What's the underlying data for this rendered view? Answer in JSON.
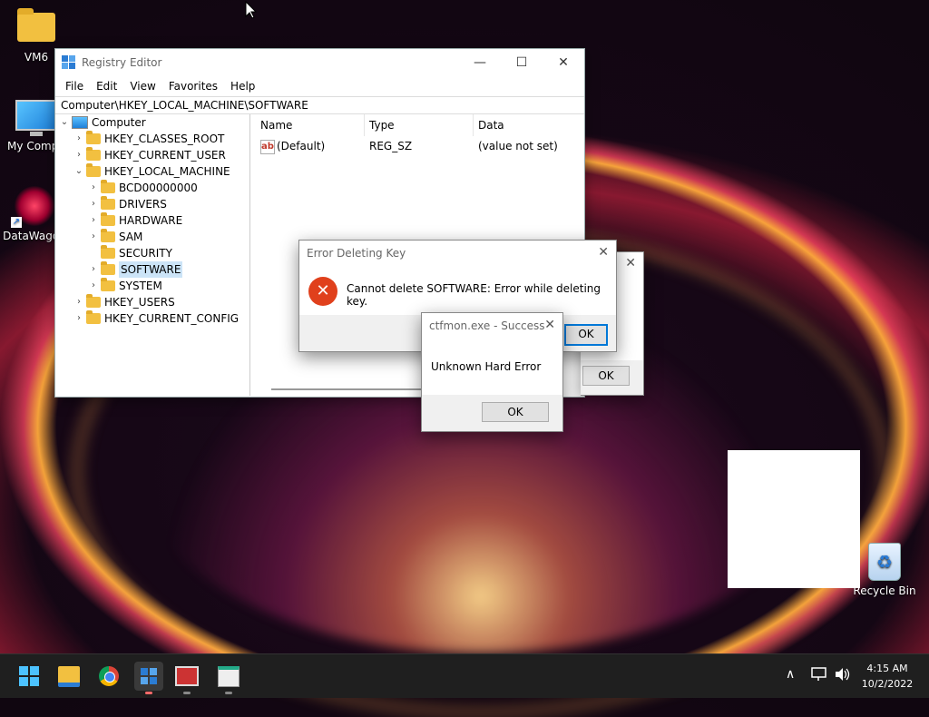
{
  "desktop": {
    "icons": [
      {
        "label": "VM6"
      },
      {
        "label": "My Compu"
      },
      {
        "label": "DataWagon"
      },
      {
        "label": "Recycle Bin"
      }
    ]
  },
  "regedit": {
    "title": "Registry Editor",
    "menu": [
      "File",
      "Edit",
      "View",
      "Favorites",
      "Help"
    ],
    "address": "Computer\\HKEY_LOCAL_MACHINE\\SOFTWARE",
    "tree": [
      {
        "label": "Computer"
      },
      {
        "label": "HKEY_CLASSES_ROOT"
      },
      {
        "label": "HKEY_CURRENT_USER"
      },
      {
        "label": "HKEY_LOCAL_MACHINE"
      },
      {
        "label": "BCD00000000"
      },
      {
        "label": "DRIVERS"
      },
      {
        "label": "HARDWARE"
      },
      {
        "label": "SAM"
      },
      {
        "label": "SECURITY"
      },
      {
        "label": "SOFTWARE"
      },
      {
        "label": "SYSTEM"
      },
      {
        "label": "HKEY_USERS"
      },
      {
        "label": "HKEY_CURRENT_CONFIG"
      }
    ],
    "columns": [
      "Name",
      "Type",
      "Data"
    ],
    "rows": [
      {
        "name": "(Default)",
        "type": "REG_SZ",
        "data": "(value not set)",
        "icon": "ab"
      }
    ]
  },
  "error_dialog": {
    "title": "Error Deleting Key",
    "message": "Cannot delete SOFTWARE:  Error while deleting key.",
    "ok": "OK"
  },
  "back_dialog": {
    "ok": "OK"
  },
  "ctfmon_dialog": {
    "title": "ctfmon.exe - Success",
    "message": "Unknown Hard Error",
    "ok": "OK"
  },
  "taskbar": {
    "time": "4:15 AM",
    "date": "10/2/2022"
  },
  "colors": {
    "accent": "#0078d7",
    "error": "#e0401c",
    "selection": "#cce4f7"
  }
}
